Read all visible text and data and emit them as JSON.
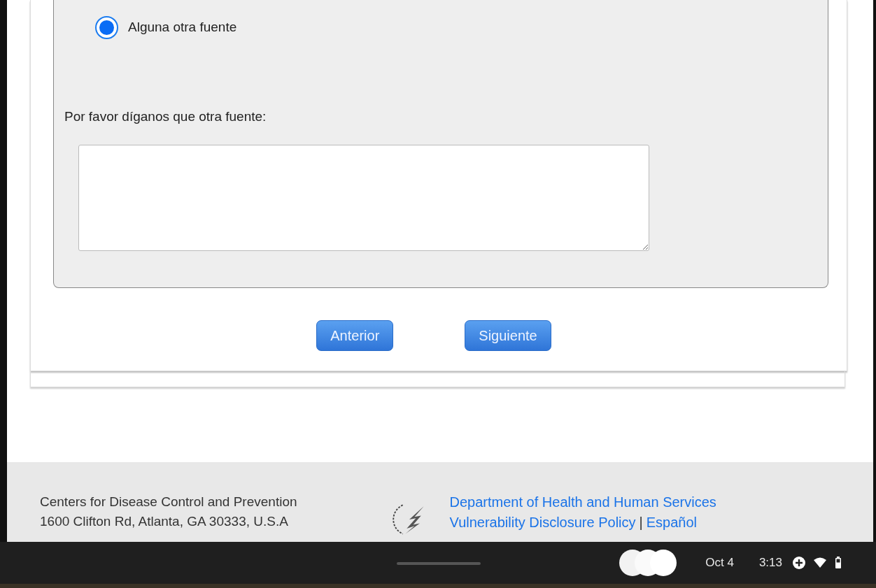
{
  "form": {
    "options": [
      {
        "label": "Alguna otra fuente",
        "selected": true
      }
    ],
    "prompt": "Por favor díganos que otra fuente:",
    "buttons": [
      {
        "label": "Anterior"
      },
      {
        "label": "Siguiente"
      }
    ]
  },
  "footer": {
    "organization": "Centers for Disease Control and Prevention",
    "address": "1600 Clifton Rd, Atlanta, GA 30333, U.S.A",
    "links": [
      {
        "label": "Department of Health and Human Services"
      }
    ],
    "policy_links": [
      {
        "label": "Vulnerability Disclosure Policy"
      },
      {
        "label": "Español"
      }
    ],
    "separator": "|"
  },
  "shelf": {
    "date": "Oct 4",
    "time": "3:13"
  }
}
